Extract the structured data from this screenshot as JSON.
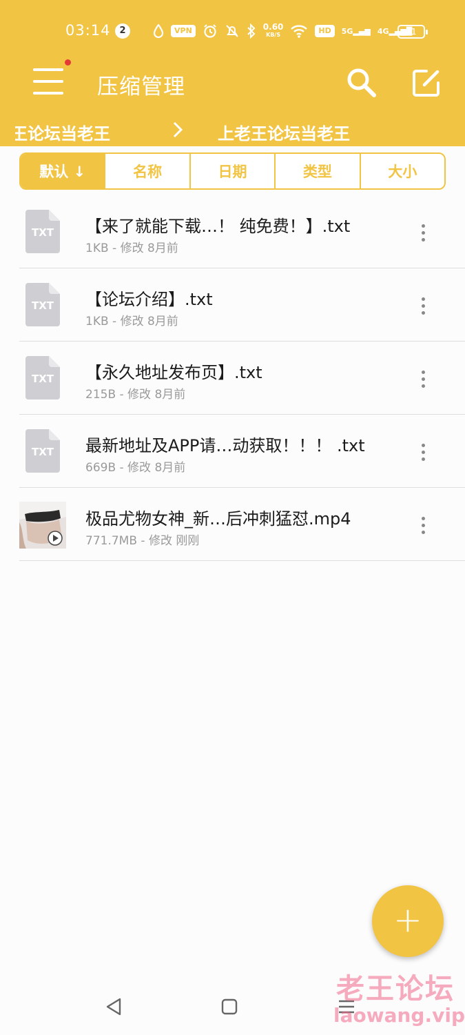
{
  "status_bar": {
    "time": "03:14",
    "notification_count": "2",
    "vpn_label": "VPN",
    "speed_value": "0.60",
    "speed_unit": "KB/S",
    "hd_label": "HD",
    "sim1_label": "5G",
    "sim2_label": "4G",
    "battery": "21"
  },
  "toolbar": {
    "title": "压缩管理",
    "menu_icon": "hamburger-menu-icon",
    "search_icon": "search-icon",
    "edit_icon": "edit-icon"
  },
  "breadcrumb": {
    "parent": "老王论坛当老王",
    "current": "上老王论坛当老王"
  },
  "sort_tabs": [
    {
      "label": "默认 ↓",
      "active": true
    },
    {
      "label": "名称",
      "active": false
    },
    {
      "label": "日期",
      "active": false
    },
    {
      "label": "类型",
      "active": false
    },
    {
      "label": "大小",
      "active": false
    }
  ],
  "files": [
    {
      "name": "【来了就能下载…！ 纯免费！】.txt",
      "meta": "1KB - 修改 8月前",
      "icon_label": "TXT",
      "type": "txt"
    },
    {
      "name": "【论坛介绍】.txt",
      "meta": "1KB - 修改 8月前",
      "icon_label": "TXT",
      "type": "txt"
    },
    {
      "name": "【永久地址发布页】.txt",
      "meta": "215B - 修改 8月前",
      "icon_label": "TXT",
      "type": "txt"
    },
    {
      "name": "最新地址及APP请…动获取！！！ .txt",
      "meta": "669B - 修改 8月前",
      "icon_label": "TXT",
      "type": "txt"
    },
    {
      "name": "极品尤物女神_新…后冲刺猛怼.mp4",
      "meta": "771.7MB - 修改 刚刚",
      "icon_label": "",
      "type": "video"
    }
  ],
  "fab": {
    "label": "+"
  },
  "watermark": {
    "title": "老王论坛",
    "url": "laowang.vip"
  },
  "colors": {
    "accent": "#f2c443",
    "badge": "#e53935"
  }
}
